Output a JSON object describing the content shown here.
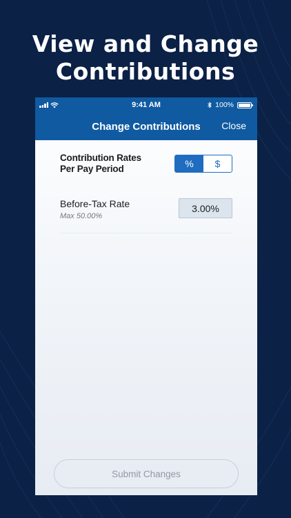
{
  "headline": {
    "line1": "View and Change",
    "line2": "Contributions"
  },
  "status_bar": {
    "time": "9:41 AM",
    "battery": "100%"
  },
  "nav": {
    "title": "Change Contributions",
    "close_label": "Close"
  },
  "contribution_rates": {
    "label_line1": "Contribution Rates",
    "label_line2": "Per Pay Period",
    "toggle": {
      "percent_label": "%",
      "dollar_label": "$",
      "selected": "%"
    }
  },
  "before_tax": {
    "label": "Before-Tax Rate",
    "max_text": "Max 50.00%",
    "value": "3.00%"
  },
  "submit": {
    "label": "Submit Changes"
  },
  "colors": {
    "background": "#0b2146",
    "header_blue": "#105aa1",
    "accent_blue": "#1f6cc0"
  },
  "icons": [
    "signal-icon",
    "wifi-icon",
    "bluetooth-icon",
    "battery-icon"
  ]
}
